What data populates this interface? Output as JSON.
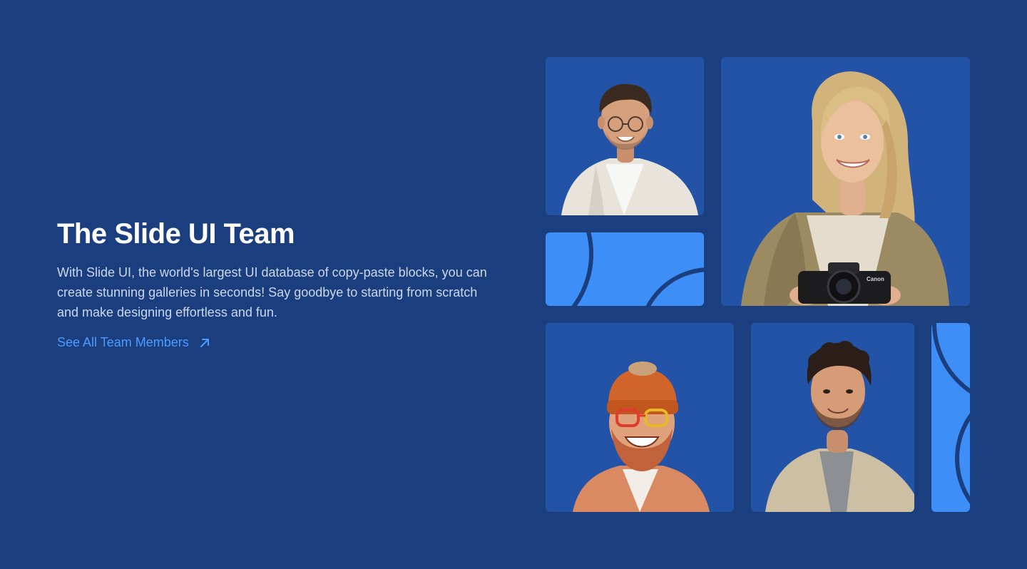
{
  "section": {
    "title": "The Slide UI Team",
    "description": "With Slide UI, the world's largest UI database of copy-paste blocks, you can create stunning galleries in seconds! Say goodbye to starting from scratch and make designing effortless and fun.",
    "cta_label": "See All Team Members",
    "cta_icon": "arrow-up-right-icon"
  },
  "gallery": {
    "photos": [
      {
        "subject": "man with glasses and white shirt"
      },
      {
        "subject": "blonde woman holding camera",
        "camera_brand": "Canon"
      },
      {
        "subject": "bearded man with orange beanie and red glasses"
      },
      {
        "subject": "man with curly hair and beige jacket"
      }
    ],
    "decor_tiles": [
      "arc-pattern",
      "arc-pattern"
    ]
  },
  "colors": {
    "background": "#1b3f7e",
    "tile": "#2253a6",
    "accent": "#3d8ff7",
    "link": "#4c9bff",
    "title": "#ffffff",
    "text": "#c9d7ef"
  }
}
